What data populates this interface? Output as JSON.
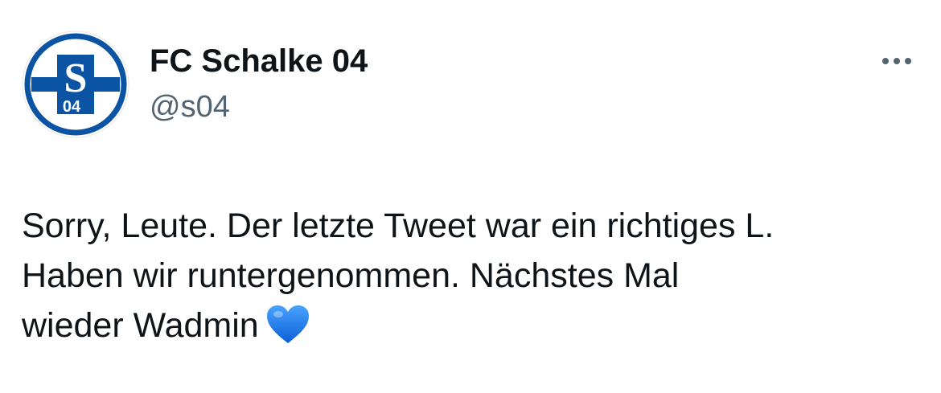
{
  "author": {
    "display_name": "FC Schalke 04",
    "handle": "@s04",
    "avatar_icon": "schalke-crest-icon",
    "brand_color": "#0b53a3"
  },
  "more_button": {
    "icon": "more-horizontal-icon"
  },
  "tweet": {
    "lines": [
      "Sorry, Leute. Der letzte Tweet war ein richtiges L.",
      "Haben wir runtergenommen. Nächstes Mal",
      "wieder Wadmin"
    ],
    "emoji_icon": "blue-heart-icon",
    "emoji_color": "#1a6fe0"
  },
  "avatar_letters": {
    "big": "S",
    "small": "04"
  }
}
